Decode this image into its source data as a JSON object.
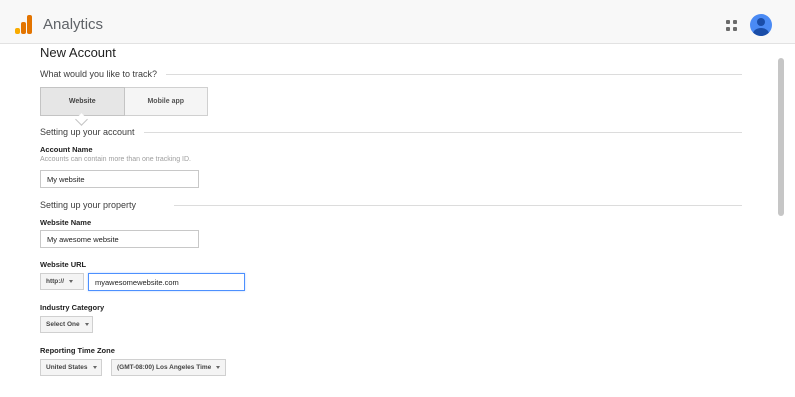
{
  "header": {
    "app_title": "Analytics",
    "logo_colors": [
      "#f9ab00",
      "#e37400",
      "#e37400"
    ]
  },
  "page": {
    "title": "New Account",
    "track_question": "What would you like to track?",
    "tabs": [
      {
        "label": "Website",
        "selected": true
      },
      {
        "label": "Mobile app",
        "selected": false
      }
    ]
  },
  "account_section": {
    "heading": "Setting up your account",
    "account_name_label": "Account Name",
    "account_name_help": "Accounts can contain more than one tracking ID.",
    "account_name_value": "My website"
  },
  "property_section": {
    "heading": "Setting up your property",
    "website_name_label": "Website Name",
    "website_name_value": "My awesome website",
    "website_url_label": "Website URL",
    "protocol_value": "http://",
    "website_url_value": "myawesomewebsite.com",
    "industry_label": "Industry Category",
    "industry_value": "Select One",
    "timezone_label": "Reporting Time Zone",
    "country_value": "United States",
    "timezone_value": "(GMT-08:00) Los Angeles Time"
  },
  "icons": [
    "analytics-logo",
    "apps-grid-icon",
    "account-avatar-icon",
    "chevron-down-icon"
  ]
}
